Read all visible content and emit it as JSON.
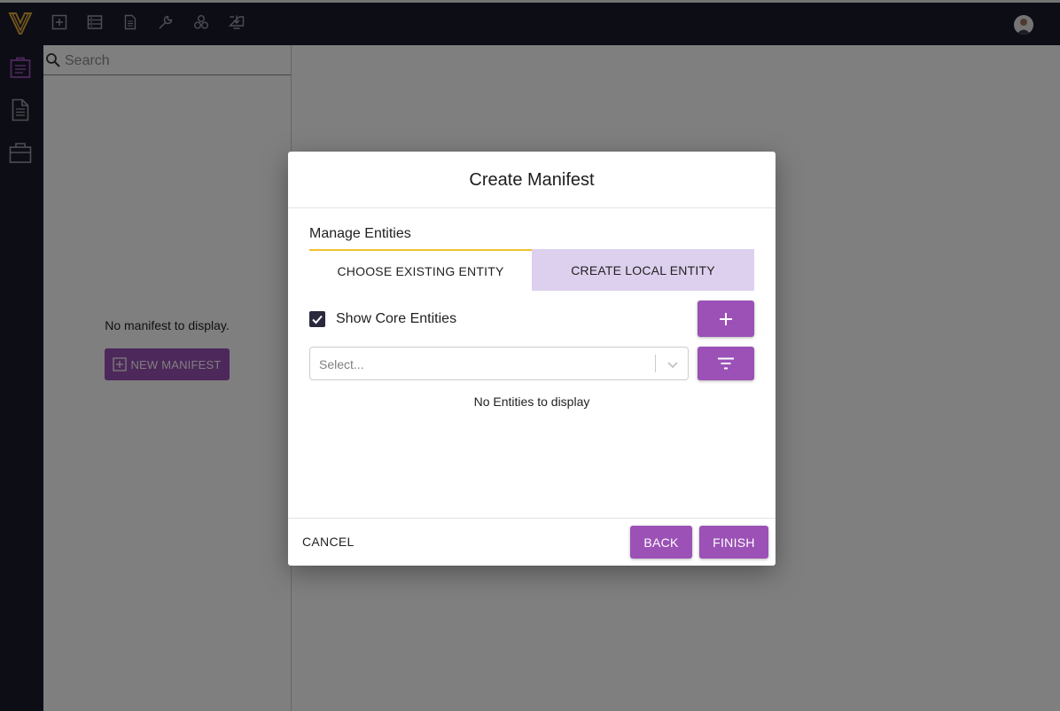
{
  "colors": {
    "sidebar_bg": "#1b1a2b",
    "accent": "#9b51b6",
    "tab_indicator": "#f2c230",
    "tab_selected_bg": "#ddd0ee",
    "logo": "#e0a93a"
  },
  "topbar": {
    "icons": [
      "add-icon",
      "list-icon",
      "document-icon",
      "wrench-icon",
      "network-icon",
      "download-icon"
    ]
  },
  "rail": {
    "icons": [
      "manifest-icon",
      "document-icon",
      "package-icon"
    ]
  },
  "panel": {
    "search": {
      "placeholder": "Search",
      "value": ""
    },
    "empty_message": "No manifest to display.",
    "new_button_label": "NEW MANIFEST"
  },
  "dialog": {
    "title": "Create Manifest",
    "section_title": "Manage Entities",
    "tabs": [
      {
        "label": "CHOOSE EXISTING ENTITY",
        "active": true
      },
      {
        "label": "CREATE LOCAL ENTITY",
        "active": false
      }
    ],
    "show_core_entities": {
      "label": "Show Core Entities",
      "checked": true
    },
    "select": {
      "placeholder": "Select..."
    },
    "empty_message": "No Entities to display",
    "footer": {
      "cancel_label": "CANCEL",
      "back_label": "BACK",
      "finish_label": "FINISH"
    }
  }
}
